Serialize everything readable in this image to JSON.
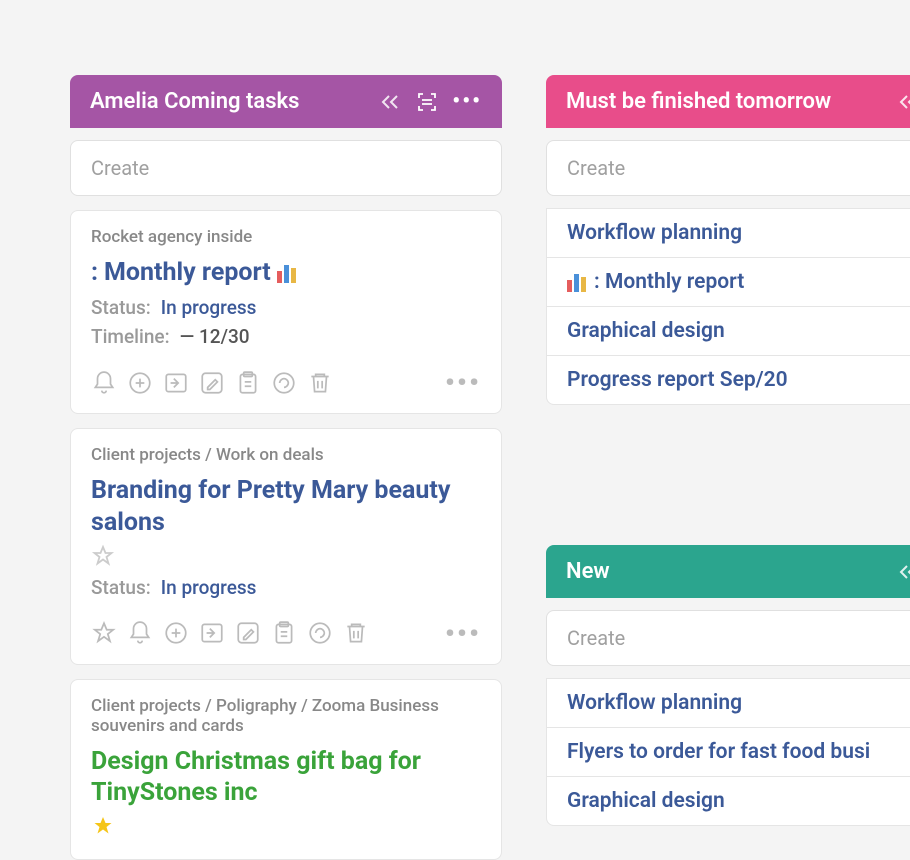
{
  "columns": {
    "left": {
      "title": "Amelia Coming tasks",
      "create": "Create",
      "cards": [
        {
          "path": "Rocket agency inside",
          "title_prefix": ":",
          "title": "Monthly report",
          "status_label": "Status:",
          "status": "In progress",
          "timeline_label": "Timeline:",
          "timeline": "—  12/30"
        },
        {
          "path": "Client projects / Work on deals",
          "title": "Branding for Pretty Mary beauty salons",
          "status_label": "Status:",
          "status": "In progress"
        },
        {
          "path": "Client projects / Poligraphy / Zooma Business souvenirs and cards",
          "title": "Design Christmas gift bag for TinyStones inc"
        }
      ]
    },
    "right1": {
      "title": "Must be finished tomorrow",
      "create": "Create",
      "items": [
        "Workflow planning",
        ": Monthly report",
        "Graphical design",
        "Progress report Sep/20"
      ]
    },
    "right2": {
      "title": "New",
      "create": "Create",
      "items": [
        "Workflow planning",
        "Flyers to order for fast food busi",
        "Graphical design"
      ]
    }
  }
}
